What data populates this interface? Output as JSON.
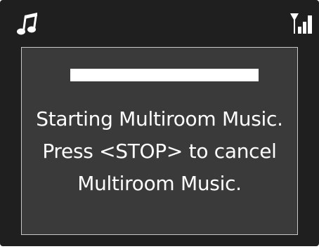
{
  "status_bar": {
    "left_icon": "music-note-icon",
    "right_icon": "signal-strength-icon"
  },
  "dialog": {
    "progress": 1.0,
    "message_lines": [
      "Starting Multiroom Music.",
      "Press <STOP> to cancel",
      "Multiroom Music."
    ]
  },
  "colors": {
    "screen_background": "#1f1f1f",
    "dialog_background": "#3a3a3a",
    "dialog_border": "#c8c8c8",
    "text": "#ffffff",
    "progress_fill": "#ffffff"
  }
}
